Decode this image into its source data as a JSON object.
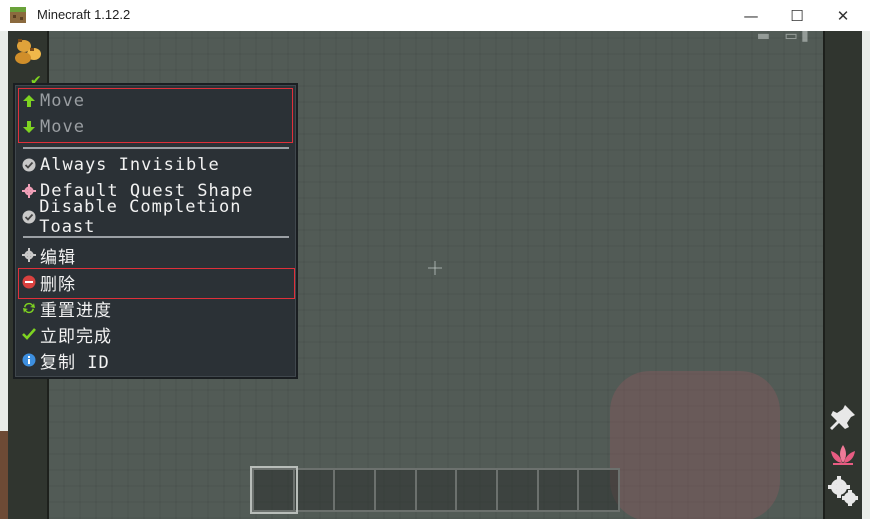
{
  "window": {
    "title": "Minecraft 1.12.2",
    "minimize": "—",
    "maximize": "☐",
    "close": "✕"
  },
  "menu": {
    "move_group": [
      {
        "label": "Move",
        "icon": "arrow-up-icon"
      },
      {
        "label": "Move",
        "icon": "arrow-down-icon"
      }
    ],
    "options": [
      {
        "label": "Always Invisible",
        "icon": "check-circle-icon"
      },
      {
        "label": "Default Quest Shape",
        "icon": "gear-pink-icon"
      },
      {
        "label": "Disable Completion Toast",
        "icon": "check-circle-icon"
      }
    ],
    "actions": [
      {
        "label": "编辑",
        "icon": "gear-icon"
      },
      {
        "label": "删除",
        "icon": "minus-circle-icon"
      },
      {
        "label": "重置进度",
        "icon": "refresh-icon"
      },
      {
        "label": "立即完成",
        "icon": "check-icon"
      },
      {
        "label": "复制 ID",
        "icon": "info-icon"
      }
    ]
  },
  "colors": {
    "menu_bg": "#2b3136",
    "highlight": "#e0303a",
    "accent_green": "#7ed321",
    "danger_red": "#d9413f",
    "info_blue": "#3d8fe0"
  }
}
